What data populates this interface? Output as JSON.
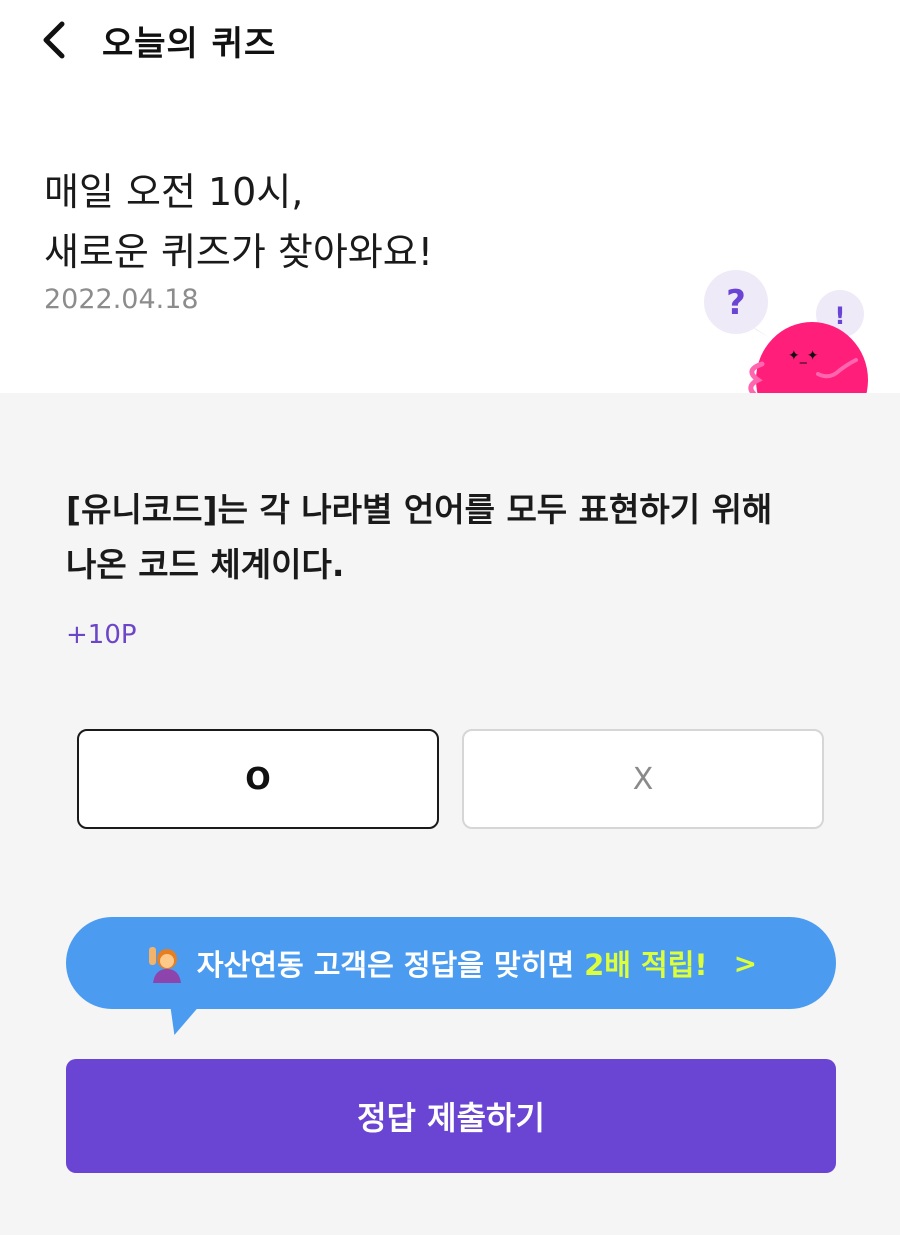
{
  "header": {
    "title": "오늘의 퀴즈"
  },
  "hero": {
    "line1": "매일 오전 10시,",
    "line2": "새로운 퀴즈가 찾아와요!",
    "date": "2022.04.18"
  },
  "mascot": {
    "bubble_question": "?",
    "bubble_exclaim": "!"
  },
  "quiz": {
    "question_line1": "[유니코드]는 각 나라별 언어를 모두 표현하기 위해",
    "question_line2": "나온 코드 체계이다.",
    "points": "+10P",
    "option_o": "O",
    "option_x": "X"
  },
  "promo": {
    "text": "자산연동 고객은 정답을 맞히면",
    "highlight": "2배 적립!",
    "arrow": ">"
  },
  "submit": {
    "label": "정답 제출하기"
  },
  "colors": {
    "accent_purple": "#6a44d2",
    "promo_blue": "#4b9cf0",
    "highlight_green": "#ddff3b",
    "mascot_pink": "#ff1f7a"
  },
  "icons": {
    "back": "chevron-left-icon",
    "promo": "person-raising-hand-icon",
    "mascot": "pink-blob-mascot"
  }
}
